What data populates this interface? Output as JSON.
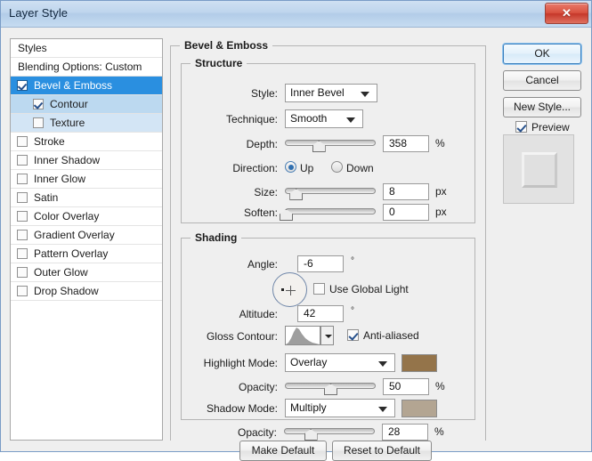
{
  "window": {
    "title": "Layer Style",
    "close_label": "✕"
  },
  "styles_panel": {
    "header": "Styles",
    "blending_options": "Blending Options: Custom",
    "items": [
      {
        "label": "Bevel & Emboss",
        "checked": true,
        "selected": true,
        "level": 0
      },
      {
        "label": "Contour",
        "checked": true,
        "selected": false,
        "level": 1
      },
      {
        "label": "Texture",
        "checked": false,
        "selected": false,
        "level": 1
      },
      {
        "label": "Stroke",
        "checked": false,
        "selected": false,
        "level": 0
      },
      {
        "label": "Inner Shadow",
        "checked": false,
        "selected": false,
        "level": 0
      },
      {
        "label": "Inner Glow",
        "checked": false,
        "selected": false,
        "level": 0
      },
      {
        "label": "Satin",
        "checked": false,
        "selected": false,
        "level": 0
      },
      {
        "label": "Color Overlay",
        "checked": false,
        "selected": false,
        "level": 0
      },
      {
        "label": "Gradient Overlay",
        "checked": false,
        "selected": false,
        "level": 0
      },
      {
        "label": "Pattern Overlay",
        "checked": false,
        "selected": false,
        "level": 0
      },
      {
        "label": "Outer Glow",
        "checked": false,
        "selected": false,
        "level": 0
      },
      {
        "label": "Drop Shadow",
        "checked": false,
        "selected": false,
        "level": 0
      }
    ]
  },
  "main": {
    "section_title": "Bevel & Emboss",
    "structure": {
      "title": "Structure",
      "style_label": "Style:",
      "style_value": "Inner Bevel",
      "technique_label": "Technique:",
      "technique_value": "Smooth",
      "depth_label": "Depth:",
      "depth_value": "358",
      "depth_unit": "%",
      "depth_percent": 36,
      "direction_label": "Direction:",
      "direction_up": "Up",
      "direction_down": "Down",
      "direction_selected": "Up",
      "size_label": "Size:",
      "size_value": "8",
      "size_unit": "px",
      "size_percent": 11,
      "soften_label": "Soften:",
      "soften_value": "0",
      "soften_unit": "px",
      "soften_percent": 0
    },
    "shading": {
      "title": "Shading",
      "angle_label": "Angle:",
      "angle_value": "-6",
      "angle_unit": "°",
      "use_global_light": "Use Global Light",
      "use_global_light_checked": false,
      "altitude_label": "Altitude:",
      "altitude_value": "42",
      "altitude_unit": "°",
      "gloss_contour_label": "Gloss Contour:",
      "anti_aliased": "Anti-aliased",
      "anti_aliased_checked": true,
      "highlight_mode_label": "Highlight Mode:",
      "highlight_mode_value": "Overlay",
      "highlight_color": "#94744a",
      "highlight_opacity_label": "Opacity:",
      "highlight_opacity_value": "50",
      "highlight_opacity_unit": "%",
      "highlight_opacity_percent": 49,
      "shadow_mode_label": "Shadow Mode:",
      "shadow_mode_value": "Multiply",
      "shadow_color": "#b3a592",
      "shadow_opacity_label": "Opacity:",
      "shadow_opacity_value": "28",
      "shadow_opacity_unit": "%",
      "shadow_opacity_percent": 28
    },
    "make_default": "Make Default",
    "reset_to_default": "Reset to Default"
  },
  "right": {
    "ok": "OK",
    "cancel": "Cancel",
    "new_style": "New Style...",
    "preview_label": "Preview",
    "preview_checked": true
  }
}
